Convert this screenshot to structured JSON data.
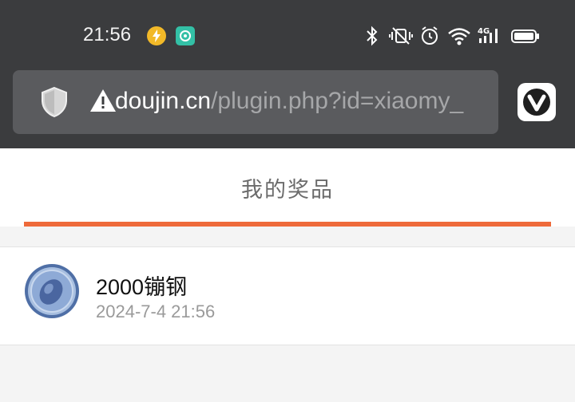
{
  "status_bar": {
    "time": "21:56",
    "icons": [
      "lightning-notification-icon",
      "app-notification-icon",
      "bluetooth-icon",
      "vibrate-silent-icon",
      "alarm-icon",
      "wifi-icon",
      "4g-signal-icon",
      "battery-icon"
    ]
  },
  "browser": {
    "url_host": "doujin.cn",
    "url_path": "/plugin.php?id=xiaomy_",
    "security_icon": "warning-icon",
    "accent": "#ee6a3a"
  },
  "page": {
    "title": "我的奖品"
  },
  "prizes": [
    {
      "name": "2000镚钢",
      "time": "2024-7-4 21:56"
    }
  ]
}
